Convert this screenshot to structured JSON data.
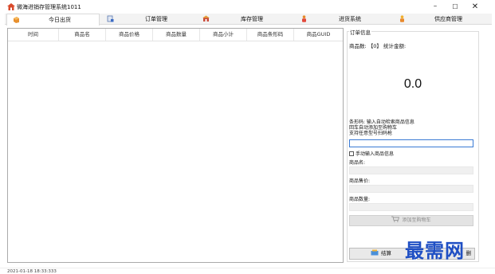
{
  "window": {
    "title": "微海进销存管理系统1011",
    "controls": {
      "minimize": "–",
      "maximize": "☐",
      "close": "✕"
    }
  },
  "tabs": [
    {
      "label": "今日出货",
      "icon": "box-icon",
      "active": true
    },
    {
      "label": "订单管理",
      "icon": "document-icon",
      "active": false
    },
    {
      "label": "库存管理",
      "icon": "warehouse-icon",
      "active": false
    },
    {
      "label": "进货系统",
      "icon": "person-icon",
      "active": false
    },
    {
      "label": "供应商管理",
      "icon": "supplier-icon",
      "active": false
    }
  ],
  "grid": {
    "columns": [
      "时间",
      "商品名",
      "商品价格",
      "商品数量",
      "商品小计",
      "商品条形码",
      "商品GUID"
    ],
    "rows": []
  },
  "order_info": {
    "group_title": "订单信息",
    "summary_line": "商品数: 【0】 统计金额:",
    "total": "0.0",
    "hints": [
      "条形码: 输入自动检索商品信息",
      "回车自动添加至购物车",
      "支持任意型号扫码枪"
    ],
    "barcode_value": "",
    "manual_checkbox_label": "手动输入商品信息",
    "manual_checked": false,
    "fields": [
      {
        "label": "商品名:",
        "value": ""
      },
      {
        "label": "商品售价:",
        "value": ""
      },
      {
        "label": "商品数量:",
        "value": ""
      }
    ],
    "add_to_cart_label": "添加至购物车",
    "checkout_label": "结算",
    "second_button_label": "删"
  },
  "watermark": "最需网",
  "status": {
    "text": "2021-01-18 18:33:333"
  },
  "colors": {
    "accent": "#3a7bd5",
    "watermark": "#1f4fc4",
    "disabled_button": "#e3e3e3"
  }
}
